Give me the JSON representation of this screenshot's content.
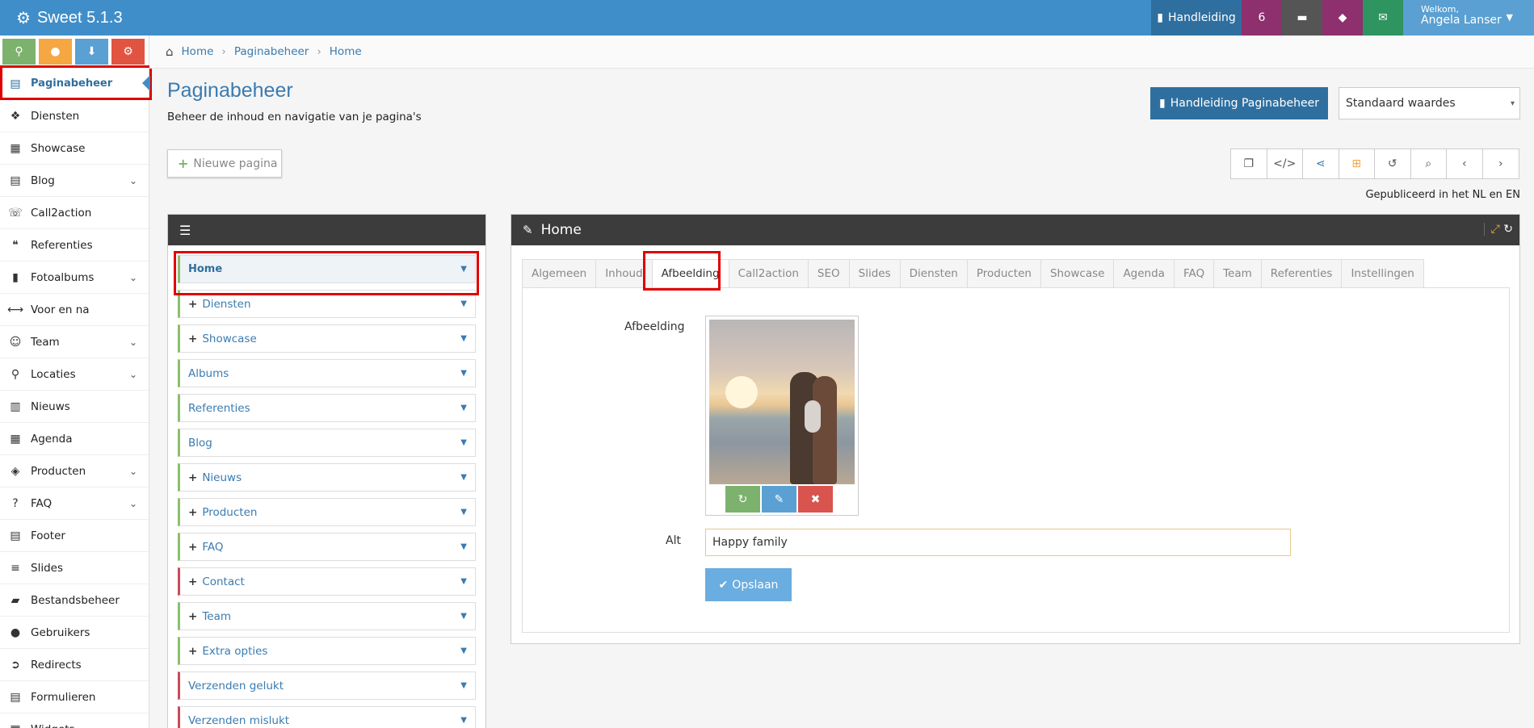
{
  "app": {
    "title": "Sweet 5.1.3"
  },
  "topbar": {
    "manual_label": "Handleiding",
    "count": "6",
    "welcome": "Welkom,",
    "user": "Angela Lanser",
    "colors": {
      "bar": "#3f8ec9",
      "count": "#8e2f6e",
      "mail": "#2e9460"
    }
  },
  "sidebar": {
    "items": [
      {
        "label": "Paginabeheer",
        "icon": "table-icon",
        "active": true
      },
      {
        "label": "Diensten",
        "icon": "cubes-icon"
      },
      {
        "label": "Showcase",
        "icon": "grid-icon"
      },
      {
        "label": "Blog",
        "icon": "document-icon",
        "expandable": true
      },
      {
        "label": "Call2action",
        "icon": "phone-icon"
      },
      {
        "label": "Referenties",
        "icon": "comments-icon"
      },
      {
        "label": "Fotoalbums",
        "icon": "book-icon",
        "expandable": true
      },
      {
        "label": "Voor en na",
        "icon": "arrows-h-icon"
      },
      {
        "label": "Team",
        "icon": "users-icon",
        "expandable": true
      },
      {
        "label": "Locaties",
        "icon": "map-marker-icon",
        "expandable": true
      },
      {
        "label": "Nieuws",
        "icon": "newspaper-icon"
      },
      {
        "label": "Agenda",
        "icon": "calendar-icon"
      },
      {
        "label": "Producten",
        "icon": "tags-icon",
        "expandable": true
      },
      {
        "label": "FAQ",
        "icon": "question-icon",
        "expandable": true
      },
      {
        "label": "Footer",
        "icon": "list-alt-icon"
      },
      {
        "label": "Slides",
        "icon": "sliders-icon"
      },
      {
        "label": "Bestandsbeheer",
        "icon": "folder-open-icon"
      },
      {
        "label": "Gebruikers",
        "icon": "user-icon"
      },
      {
        "label": "Redirects",
        "icon": "arrow-circle-icon"
      },
      {
        "label": "Formulieren",
        "icon": "form-icon"
      },
      {
        "label": "Widgets",
        "icon": "widget-icon"
      }
    ]
  },
  "breadcrumb": [
    "Home",
    "Paginabeheer",
    "Home"
  ],
  "page": {
    "title": "Paginabeheer",
    "subtitle": "Beheer de inhoud en navigatie van je pagina's",
    "manual_button": "Handleiding Paginabeheer",
    "select_value": "Standaard waardes",
    "new_page": "Nieuwe pagina",
    "published": "Gepubliceerd in het NL en EN"
  },
  "tree": {
    "items": [
      {
        "label": "Home",
        "plus": false,
        "accent": "green",
        "active": true
      },
      {
        "label": "Diensten",
        "plus": true,
        "accent": "green"
      },
      {
        "label": "Showcase",
        "plus": true,
        "accent": "green"
      },
      {
        "label": "Albums",
        "plus": false,
        "accent": "green"
      },
      {
        "label": "Referenties",
        "plus": false,
        "accent": "green"
      },
      {
        "label": "Blog",
        "plus": false,
        "accent": "green"
      },
      {
        "label": "Nieuws",
        "plus": true,
        "accent": "green"
      },
      {
        "label": "Producten",
        "plus": true,
        "accent": "green"
      },
      {
        "label": "FAQ",
        "plus": true,
        "accent": "green"
      },
      {
        "label": "Contact",
        "plus": true,
        "accent": "red"
      },
      {
        "label": "Team",
        "plus": true,
        "accent": "green"
      },
      {
        "label": "Extra opties",
        "plus": true,
        "accent": "green"
      },
      {
        "label": "Verzenden gelukt",
        "plus": false,
        "accent": "red"
      },
      {
        "label": "Verzenden mislukt",
        "plus": false,
        "accent": "red"
      }
    ]
  },
  "editor": {
    "title": "Home",
    "tabs": [
      "Algemeen",
      "Inhoud",
      "Afbeelding",
      "Call2action",
      "SEO",
      "Slides",
      "Diensten",
      "Producten",
      "Showcase",
      "Agenda",
      "FAQ",
      "Team",
      "Referenties",
      "Instellingen"
    ],
    "active_tab": "Afbeelding",
    "image_label": "Afbeelding",
    "alt_label": "Alt",
    "alt_value": "Happy family",
    "save_label": "Opslaan"
  }
}
